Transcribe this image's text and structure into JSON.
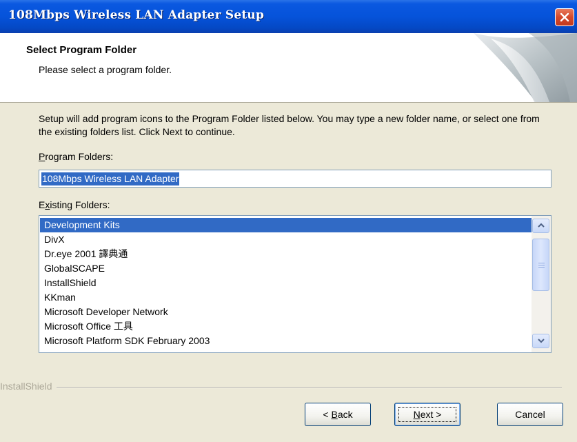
{
  "window": {
    "title": "108Mbps Wireless LAN Adapter Setup"
  },
  "header": {
    "title": "Select Program Folder",
    "subtitle": "Please select a program folder."
  },
  "main": {
    "description": "Setup will add program icons to the Program Folder listed below.  You may type a new folder name, or select one from the existing folders list.  Click Next to continue.",
    "program_folders_label": {
      "mnemonic": "P",
      "rest": "rogram Folders:"
    },
    "program_folder_value": "108Mbps Wireless LAN Adapter",
    "existing_folders_label": {
      "before": "E",
      "mnemonic": "x",
      "rest": "isting Folders:"
    },
    "existing_folders": [
      "Development Kits",
      "DivX",
      "Dr.eye 2001 譯典通",
      "GlobalSCAPE",
      "InstallShield",
      "KKman",
      "Microsoft Developer Network",
      "Microsoft Office 工具",
      "Microsoft Platform SDK February 2003"
    ],
    "selected_index": 0
  },
  "footer": {
    "brand": "InstallShield",
    "buttons": {
      "back": {
        "prefix": "< ",
        "mnemonic": "B",
        "rest": "ack"
      },
      "next": {
        "mnemonic": "N",
        "rest": "ext >"
      },
      "cancel": "Cancel"
    }
  },
  "colors": {
    "title_bar": "#0653da",
    "selection": "#316ac5",
    "dialog_bg": "#ECE9D8",
    "close_button": "#d4492c"
  },
  "icons": [
    "close-icon",
    "scroll-up-icon",
    "scroll-down-icon",
    "header-graphic"
  ]
}
